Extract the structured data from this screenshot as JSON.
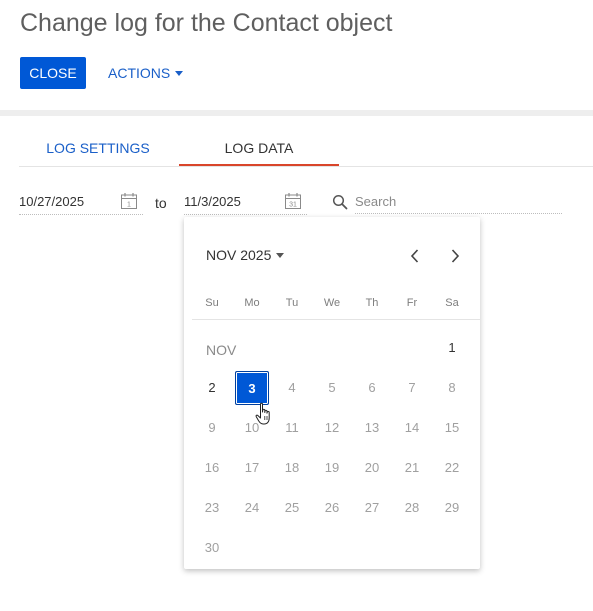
{
  "header": {
    "title": "Change log for the Contact object",
    "close_label": "CLOSE",
    "actions_label": "ACTIONS"
  },
  "tabs": [
    {
      "label": "LOG SETTINGS",
      "active": false
    },
    {
      "label": "LOG DATA",
      "active": true
    }
  ],
  "filters": {
    "date_from": "10/27/2025",
    "to_label": "to",
    "date_to": "11/3/2025",
    "calendar_icon_from_day": "1",
    "calendar_icon_to_day": "31",
    "search_placeholder": "Search",
    "search_value": ""
  },
  "calendar": {
    "month_year": "NOV 2025",
    "month_label": "NOV",
    "weekdays": [
      "Su",
      "Mo",
      "Tu",
      "We",
      "Th",
      "Fr",
      "Sa"
    ],
    "selected_day": "3",
    "weeks": [
      [
        "",
        "",
        "",
        "",
        "",
        "",
        "1"
      ],
      [
        "2",
        "3",
        "4",
        "5",
        "6",
        "7",
        "8"
      ],
      [
        "9",
        "10",
        "11",
        "12",
        "13",
        "14",
        "15"
      ],
      [
        "16",
        "17",
        "18",
        "19",
        "20",
        "21",
        "22"
      ],
      [
        "23",
        "24",
        "25",
        "26",
        "27",
        "28",
        "29"
      ],
      [
        "30",
        "",
        "",
        "",
        "",
        "",
        ""
      ]
    ],
    "enabled_days": [
      "1",
      "2",
      "3"
    ]
  },
  "colors": {
    "primary": "#0058d6",
    "link": "#1a5fc8",
    "active_tab_underline": "#d9452b"
  },
  "icons": {
    "calendar": "calendar-icon",
    "search": "search-icon",
    "prev": "chevron-left-icon",
    "next": "chevron-right-icon",
    "dropdown": "caret-down-icon",
    "cursor": "hand-pointer-icon"
  }
}
